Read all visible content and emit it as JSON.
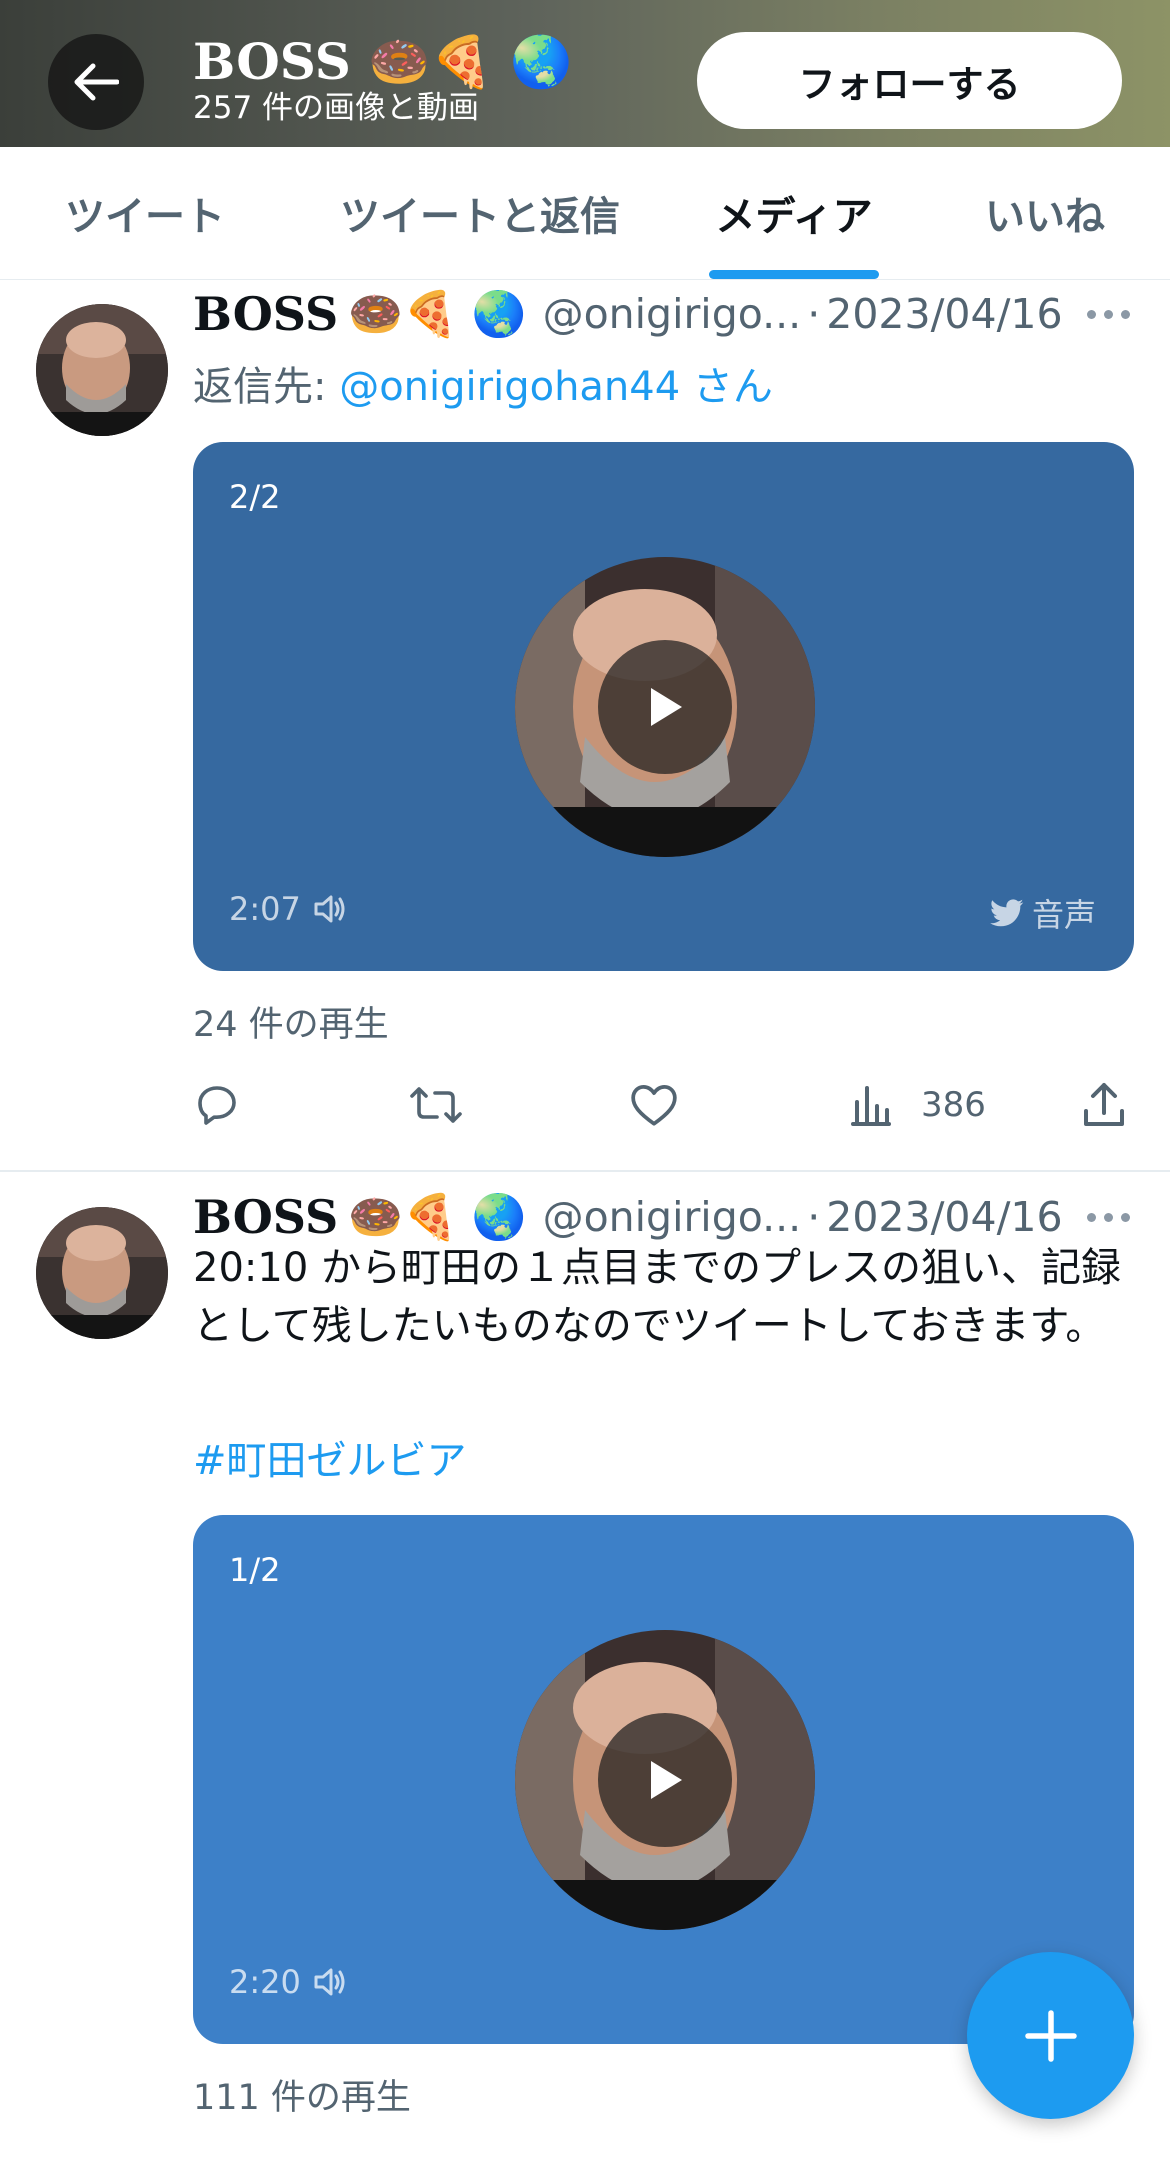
{
  "header": {
    "back_icon": "arrow-left-icon",
    "title": "BOSS 🍩🍕 🌏",
    "subtitle": "257 件の画像と動画",
    "follow_label": "フォローする"
  },
  "tabs": [
    {
      "label": "ツイート",
      "active": false
    },
    {
      "label": "ツイートと返信",
      "active": false
    },
    {
      "label": "メディア",
      "active": true
    },
    {
      "label": "いいね",
      "active": false
    }
  ],
  "tweets": [
    {
      "name": "BOSS",
      "emoji": "🍩🍕 🌏",
      "handle": "@onigirigo...",
      "separator": "·",
      "date": "2023/04/16",
      "reply_prefix": "返信先: ",
      "reply_handle": "@onigirigohan44 さん",
      "media_count": "2/2",
      "duration": "2:07",
      "audio_label": "音声",
      "media_color": "#3669a0",
      "plays": "24 件の再生",
      "views": "386"
    },
    {
      "name": "BOSS",
      "emoji": "🍩🍕 🌏",
      "handle": "@onigirigo...",
      "separator": "·",
      "date": "2023/04/16",
      "text": "20:10 から町田の１点目までのプレスの狙い、記録として残したいものなのでツイートしておきます。",
      "hashtag": "#町田ゼルビア",
      "media_count": "1/2",
      "duration": "2:20",
      "media_color": "#3d80c8",
      "plays": "111 件の再生"
    }
  ],
  "fab": {
    "icon": "compose-plus-icon"
  }
}
